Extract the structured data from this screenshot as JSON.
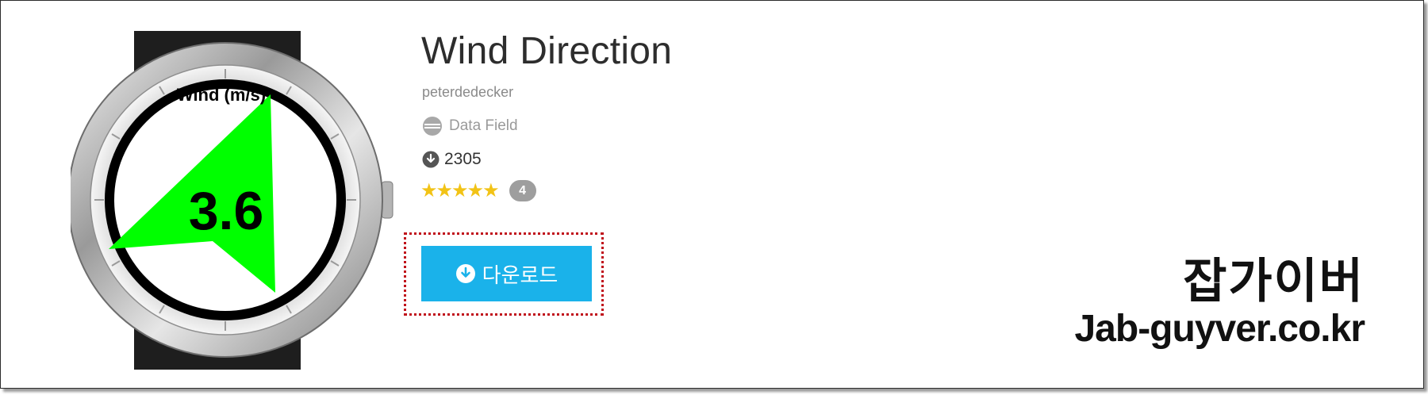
{
  "app": {
    "title": "Wind Direction",
    "author": "peterdedecker",
    "category": "Data Field",
    "downloads": "2305",
    "stars": "★★★★★",
    "rating_count": "4",
    "download_button": "다운로드"
  },
  "watch_face": {
    "label": "Wind (m/s)",
    "value": "3.6",
    "arrow_color": "#00ff00"
  },
  "watermark": {
    "korean": "잡가이버",
    "site": "Jab-guyver.co.kr"
  },
  "colors": {
    "accent": "#1ab2ea",
    "star": "#f2c316",
    "badge": "#9e9e9e",
    "highlight_outline": "#c0101a"
  },
  "icons": {
    "category": "data-field-icon",
    "downloads": "download-circle-icon",
    "button": "download-circle-icon"
  }
}
